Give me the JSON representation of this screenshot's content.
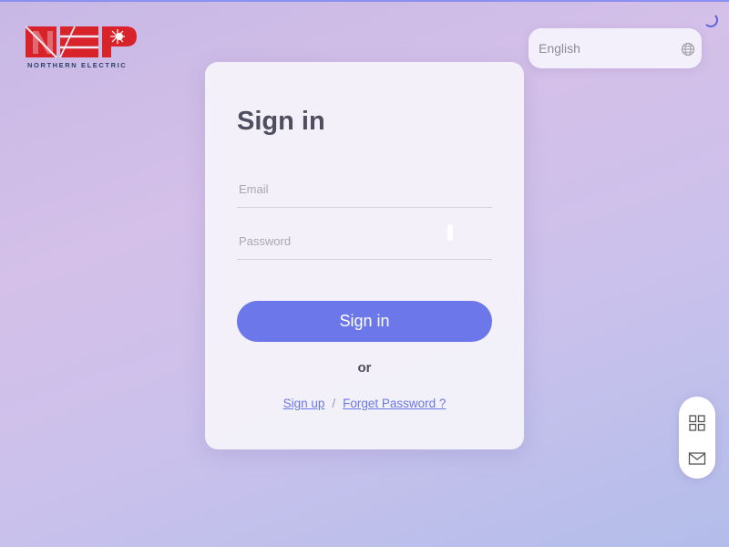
{
  "brand": {
    "logo_text": "NEP",
    "subtitle": "NORTHERN ELECTRIC",
    "color": "#d8232a"
  },
  "language": {
    "selected": "English",
    "icon": "globe-icon"
  },
  "login": {
    "title": "Sign in",
    "email_placeholder": "Email",
    "password_placeholder": "Password",
    "submit_label": "Sign in",
    "or_text": "or",
    "signup_label": "Sign up",
    "separator": "/",
    "forgot_label": "Forget Password ?"
  },
  "side_toolbar": {
    "items": [
      {
        "icon": "apps-grid-icon"
      },
      {
        "icon": "mail-icon"
      }
    ]
  },
  "colors": {
    "accent": "#6c78e9",
    "brand_red": "#d8232a"
  }
}
